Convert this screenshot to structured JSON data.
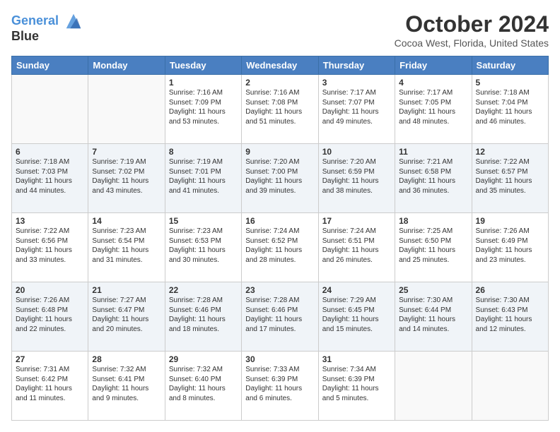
{
  "header": {
    "logo_line1": "General",
    "logo_line2": "Blue",
    "title": "October 2024",
    "subtitle": "Cocoa West, Florida, United States"
  },
  "weekdays": [
    "Sunday",
    "Monday",
    "Tuesday",
    "Wednesday",
    "Thursday",
    "Friday",
    "Saturday"
  ],
  "weeks": [
    [
      {
        "day": "",
        "sunrise": "",
        "sunset": "",
        "daylight": ""
      },
      {
        "day": "",
        "sunrise": "",
        "sunset": "",
        "daylight": ""
      },
      {
        "day": "1",
        "sunrise": "Sunrise: 7:16 AM",
        "sunset": "Sunset: 7:09 PM",
        "daylight": "Daylight: 11 hours and 53 minutes."
      },
      {
        "day": "2",
        "sunrise": "Sunrise: 7:16 AM",
        "sunset": "Sunset: 7:08 PM",
        "daylight": "Daylight: 11 hours and 51 minutes."
      },
      {
        "day": "3",
        "sunrise": "Sunrise: 7:17 AM",
        "sunset": "Sunset: 7:07 PM",
        "daylight": "Daylight: 11 hours and 49 minutes."
      },
      {
        "day": "4",
        "sunrise": "Sunrise: 7:17 AM",
        "sunset": "Sunset: 7:05 PM",
        "daylight": "Daylight: 11 hours and 48 minutes."
      },
      {
        "day": "5",
        "sunrise": "Sunrise: 7:18 AM",
        "sunset": "Sunset: 7:04 PM",
        "daylight": "Daylight: 11 hours and 46 minutes."
      }
    ],
    [
      {
        "day": "6",
        "sunrise": "Sunrise: 7:18 AM",
        "sunset": "Sunset: 7:03 PM",
        "daylight": "Daylight: 11 hours and 44 minutes."
      },
      {
        "day": "7",
        "sunrise": "Sunrise: 7:19 AM",
        "sunset": "Sunset: 7:02 PM",
        "daylight": "Daylight: 11 hours and 43 minutes."
      },
      {
        "day": "8",
        "sunrise": "Sunrise: 7:19 AM",
        "sunset": "Sunset: 7:01 PM",
        "daylight": "Daylight: 11 hours and 41 minutes."
      },
      {
        "day": "9",
        "sunrise": "Sunrise: 7:20 AM",
        "sunset": "Sunset: 7:00 PM",
        "daylight": "Daylight: 11 hours and 39 minutes."
      },
      {
        "day": "10",
        "sunrise": "Sunrise: 7:20 AM",
        "sunset": "Sunset: 6:59 PM",
        "daylight": "Daylight: 11 hours and 38 minutes."
      },
      {
        "day": "11",
        "sunrise": "Sunrise: 7:21 AM",
        "sunset": "Sunset: 6:58 PM",
        "daylight": "Daylight: 11 hours and 36 minutes."
      },
      {
        "day": "12",
        "sunrise": "Sunrise: 7:22 AM",
        "sunset": "Sunset: 6:57 PM",
        "daylight": "Daylight: 11 hours and 35 minutes."
      }
    ],
    [
      {
        "day": "13",
        "sunrise": "Sunrise: 7:22 AM",
        "sunset": "Sunset: 6:56 PM",
        "daylight": "Daylight: 11 hours and 33 minutes."
      },
      {
        "day": "14",
        "sunrise": "Sunrise: 7:23 AM",
        "sunset": "Sunset: 6:54 PM",
        "daylight": "Daylight: 11 hours and 31 minutes."
      },
      {
        "day": "15",
        "sunrise": "Sunrise: 7:23 AM",
        "sunset": "Sunset: 6:53 PM",
        "daylight": "Daylight: 11 hours and 30 minutes."
      },
      {
        "day": "16",
        "sunrise": "Sunrise: 7:24 AM",
        "sunset": "Sunset: 6:52 PM",
        "daylight": "Daylight: 11 hours and 28 minutes."
      },
      {
        "day": "17",
        "sunrise": "Sunrise: 7:24 AM",
        "sunset": "Sunset: 6:51 PM",
        "daylight": "Daylight: 11 hours and 26 minutes."
      },
      {
        "day": "18",
        "sunrise": "Sunrise: 7:25 AM",
        "sunset": "Sunset: 6:50 PM",
        "daylight": "Daylight: 11 hours and 25 minutes."
      },
      {
        "day": "19",
        "sunrise": "Sunrise: 7:26 AM",
        "sunset": "Sunset: 6:49 PM",
        "daylight": "Daylight: 11 hours and 23 minutes."
      }
    ],
    [
      {
        "day": "20",
        "sunrise": "Sunrise: 7:26 AM",
        "sunset": "Sunset: 6:48 PM",
        "daylight": "Daylight: 11 hours and 22 minutes."
      },
      {
        "day": "21",
        "sunrise": "Sunrise: 7:27 AM",
        "sunset": "Sunset: 6:47 PM",
        "daylight": "Daylight: 11 hours and 20 minutes."
      },
      {
        "day": "22",
        "sunrise": "Sunrise: 7:28 AM",
        "sunset": "Sunset: 6:46 PM",
        "daylight": "Daylight: 11 hours and 18 minutes."
      },
      {
        "day": "23",
        "sunrise": "Sunrise: 7:28 AM",
        "sunset": "Sunset: 6:46 PM",
        "daylight": "Daylight: 11 hours and 17 minutes."
      },
      {
        "day": "24",
        "sunrise": "Sunrise: 7:29 AM",
        "sunset": "Sunset: 6:45 PM",
        "daylight": "Daylight: 11 hours and 15 minutes."
      },
      {
        "day": "25",
        "sunrise": "Sunrise: 7:30 AM",
        "sunset": "Sunset: 6:44 PM",
        "daylight": "Daylight: 11 hours and 14 minutes."
      },
      {
        "day": "26",
        "sunrise": "Sunrise: 7:30 AM",
        "sunset": "Sunset: 6:43 PM",
        "daylight": "Daylight: 11 hours and 12 minutes."
      }
    ],
    [
      {
        "day": "27",
        "sunrise": "Sunrise: 7:31 AM",
        "sunset": "Sunset: 6:42 PM",
        "daylight": "Daylight: 11 hours and 11 minutes."
      },
      {
        "day": "28",
        "sunrise": "Sunrise: 7:32 AM",
        "sunset": "Sunset: 6:41 PM",
        "daylight": "Daylight: 11 hours and 9 minutes."
      },
      {
        "day": "29",
        "sunrise": "Sunrise: 7:32 AM",
        "sunset": "Sunset: 6:40 PM",
        "daylight": "Daylight: 11 hours and 8 minutes."
      },
      {
        "day": "30",
        "sunrise": "Sunrise: 7:33 AM",
        "sunset": "Sunset: 6:39 PM",
        "daylight": "Daylight: 11 hours and 6 minutes."
      },
      {
        "day": "31",
        "sunrise": "Sunrise: 7:34 AM",
        "sunset": "Sunset: 6:39 PM",
        "daylight": "Daylight: 11 hours and 5 minutes."
      },
      {
        "day": "",
        "sunrise": "",
        "sunset": "",
        "daylight": ""
      },
      {
        "day": "",
        "sunrise": "",
        "sunset": "",
        "daylight": ""
      }
    ]
  ]
}
